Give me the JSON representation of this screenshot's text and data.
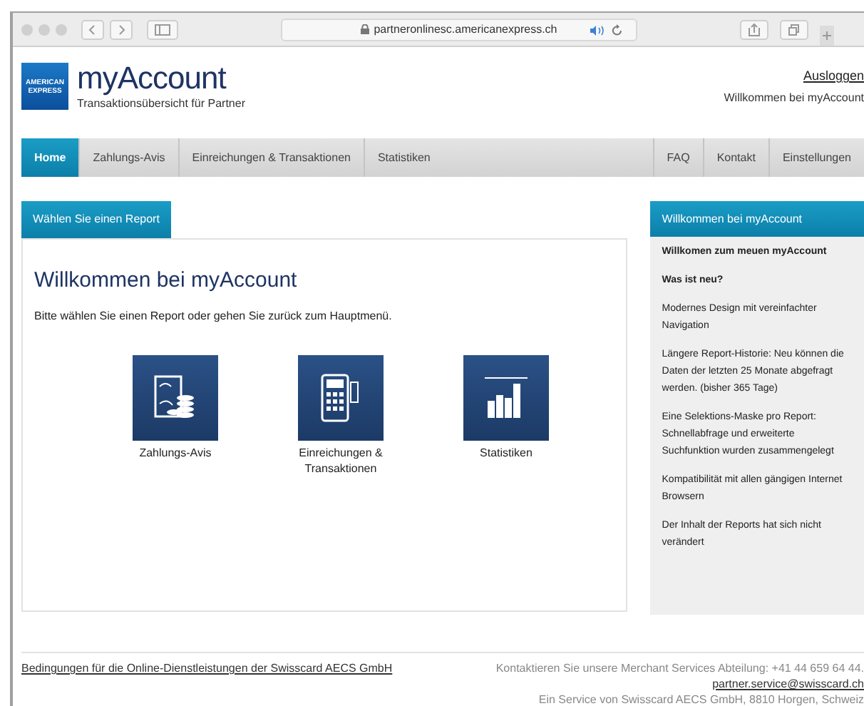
{
  "browser": {
    "url": "partneronlinesc.americanexpress.ch"
  },
  "header": {
    "logo_text": "AMERICAN EXPRESS",
    "title": "myAccount",
    "subtitle": "Transaktionsübersicht für Partner",
    "logout": "Ausloggen",
    "welcome": "Willkommen bei myAccount"
  },
  "nav": {
    "left": [
      {
        "label": "Home",
        "selected": true
      },
      {
        "label": "Zahlungs-Avis",
        "selected": false
      },
      {
        "label": "Einreichungen & Transaktionen",
        "selected": false
      },
      {
        "label": "Statistiken",
        "selected": false
      }
    ],
    "right": [
      {
        "label": "FAQ",
        "selected": false
      },
      {
        "label": "Kontakt",
        "selected": false
      },
      {
        "label": "Einstellungen",
        "selected": false
      }
    ]
  },
  "main": {
    "tab": "Wählen Sie einen Report",
    "heading": "Willkommen bei myAccount",
    "intro": "Bitte wählen Sie einen Report oder gehen Sie zurück zum Hauptmenü.",
    "reports": [
      {
        "kind": "payments",
        "label": "Zahlungs-Avis"
      },
      {
        "kind": "terminal",
        "label": "Einreichungen & Transaktionen"
      },
      {
        "kind": "stats",
        "label": "Statistiken"
      }
    ]
  },
  "sidebar": {
    "title": "Willkommen bei myAccount",
    "items": [
      {
        "text": "Willkomen zum meuen myAccount",
        "bold": true
      },
      {
        "text": "Was ist neu?",
        "bold": true
      },
      {
        "text": "Modernes Design mit vereinfachter Navigation",
        "bold": false
      },
      {
        "text": "Längere Report-Historie: Neu können die Daten der letzten 25 Monate abgefragt werden. (bisher 365 Tage)",
        "bold": false
      },
      {
        "text": "Eine Selektions-Maske pro Report: Schnellabfrage und erweiterte Suchfunktion wurden zusammengelegt",
        "bold": false
      },
      {
        "text": "Kompatibilität mit allen gängigen Internet Browsern",
        "bold": false
      },
      {
        "text": "Der Inhalt der Reports hat sich nicht verändert",
        "bold": false
      }
    ]
  },
  "footer": {
    "terms_link": "Bedingungen für die Online-Dienstleistungen der Swisscard AECS GmbH",
    "contact": "Kontaktieren Sie unsere Merchant Services Abteilung: +41 44 659 64 44.",
    "email": "partner.service@swisscard.ch",
    "service": "Ein Service von Swisscard AECS GmbH, 8810 Horgen, Schweiz"
  }
}
